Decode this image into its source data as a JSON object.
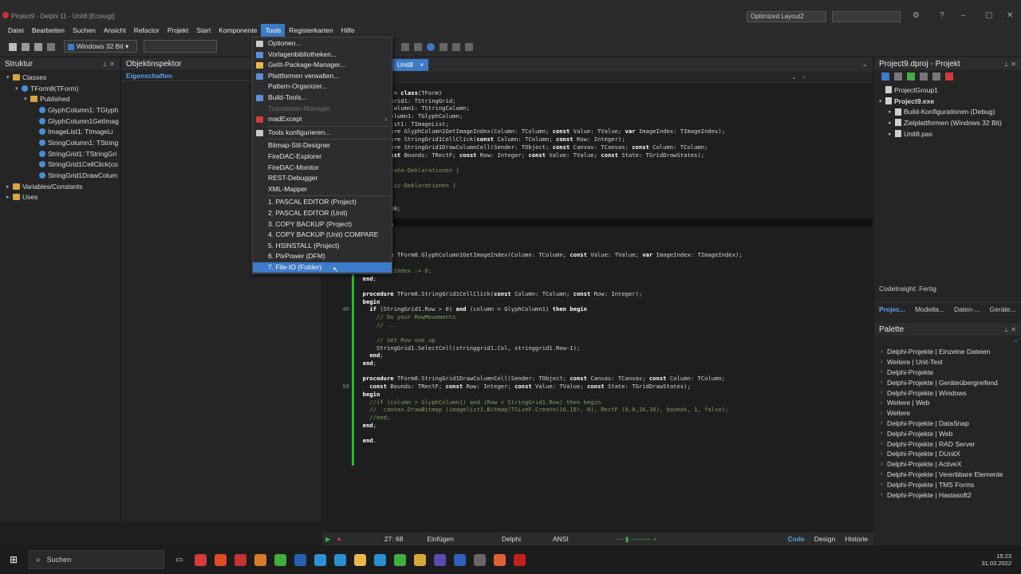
{
  "window": {
    "title": "Project9 - Delphi 11 - Unit8 [Erzeugt]",
    "layout": "Optimized Layout2"
  },
  "menubar": [
    "Datei",
    "Bearbeiten",
    "Suchen",
    "Ansicht",
    "Refactor",
    "Projekt",
    "Start",
    "Komponente",
    "Tools",
    "Registerkarten",
    "Hilfe"
  ],
  "toolbar": {
    "platform": "Windows 32 Bit"
  },
  "struktur": {
    "title": "Struktur",
    "items": [
      {
        "label": "Classes",
        "level": 0,
        "type": "folder",
        "toggle": "▾"
      },
      {
        "label": "TForm8(TForm)",
        "level": 1,
        "type": "comp",
        "toggle": "▾"
      },
      {
        "label": "Published",
        "level": 2,
        "type": "folder",
        "toggle": "▾"
      },
      {
        "label": "GlyphColumn1: TGlyph",
        "level": 3,
        "type": "comp",
        "toggle": ""
      },
      {
        "label": "GlyphColumn1GetImag",
        "level": 3,
        "type": "comp",
        "toggle": ""
      },
      {
        "label": "ImageList1: TImageLi",
        "level": 3,
        "type": "comp",
        "toggle": ""
      },
      {
        "label": "StringColumn1: TString",
        "level": 3,
        "type": "comp",
        "toggle": ""
      },
      {
        "label": "StringGrid1: TStringGri",
        "level": 3,
        "type": "comp",
        "toggle": ""
      },
      {
        "label": "StringGrid1CellClick(co",
        "level": 3,
        "type": "comp",
        "toggle": ""
      },
      {
        "label": "StringGrid1DrawColum",
        "level": 3,
        "type": "comp",
        "toggle": ""
      },
      {
        "label": "Variables/Constants",
        "level": 0,
        "type": "folder",
        "toggle": "▸"
      },
      {
        "label": "Uses",
        "level": 0,
        "type": "folder",
        "toggle": "▸"
      }
    ]
  },
  "objektinspektor": {
    "title": "Objektinspektor",
    "tab": "Eigenschaften"
  },
  "editor": {
    "tab": "Unit8",
    "tab_close": "×",
    "cursor_pos": "27: 68",
    "insert_mode": "Einfügen",
    "language": "Delphi",
    "encoding": "ANSI",
    "view_tabs": [
      "Code",
      "Design",
      "Historie"
    ],
    "code_lines": [
      {
        "n": "",
        "t": "           = class(TForm)"
      },
      {
        "n": "",
        "t": "      ringGrid1: TStringGrid;"
      },
      {
        "n": "",
        "t": "      ringColumn1: TStringColumn;"
      },
      {
        "n": "",
        "t": "      yphColumn1: TGlyphColumn;"
      },
      {
        "n": "",
        "t": "      ageList1: TImageList;"
      },
      {
        "n": "",
        "t": "      ocedure GlyphColumn1GetImageIndex(Column: TColumn; const Value: TValue; var ImageIndex: TImageIndex);"
      },
      {
        "n": "",
        "t": "      ocedure StringGrid1CellClick(const Column: TColumn; const Row: Integer);"
      },
      {
        "n": "",
        "t": "      ocedure StringGrid1DrawColumnCell(Sender: TObject; const Canvas: TCanvas; const Column: TColumn;"
      },
      {
        "n": "",
        "t": "        const Bounds: TRectF; const Row: Integer; const Value: TValue; const State: TGridDrawStates);"
      },
      {
        "n": "",
        "t": "      vate"
      },
      {
        "n": "",
        "t": "       Private-Deklarationen }"
      },
      {
        "n": "",
        "t": ""
      },
      {
        "n": "",
        "t": "       Public-Deklarationen }"
      },
      {
        "n": "",
        "t": ""
      },
      {
        "n": "",
        "t": ""
      },
      {
        "n": "",
        "t": "    : TForm8;"
      },
      {
        "n": "",
        "t": ""
      },
      {
        "n": "",
        "t": "  mentation"
      },
      {
        "n": "",
        "t": ""
      },
      {
        "n": "",
        "t": "  .fmx}"
      },
      {
        "n": "",
        "t": ""
      },
      {
        "n": "",
        "t": "  procedure TForm8.GlyphColumn1GetImageIndex(Column: TColumn; const Value: TValue; var ImageIndex: TImageIndex);"
      },
      {
        "n": "",
        "t": "  begin"
      },
      {
        "n": "",
        "t": "    //ImageIndex := 0;"
      },
      {
        "n": "",
        "t": "  end;"
      },
      {
        "n": "",
        "t": ""
      },
      {
        "n": "",
        "t": "  procedure TForm8.StringGrid1CellClick(const Column: TColumn; const Row: Integer);"
      },
      {
        "n": "",
        "t": "  begin"
      },
      {
        "n": "40",
        "t": "    if (StringGrid1.Row > 0) and (column = GlyphColumn1) then begin"
      },
      {
        "n": "",
        "t": "      // Do your RowMovements"
      },
      {
        "n": "",
        "t": "      // ..."
      },
      {
        "n": "",
        "t": ""
      },
      {
        "n": "",
        "t": "      // Set Row one up"
      },
      {
        "n": "",
        "t": "      StringGrid1.SelectCell(stringgrid1.Col, stringgrid1.Row-1);"
      },
      {
        "n": "",
        "t": "    end;"
      },
      {
        "n": "",
        "t": "  end;"
      },
      {
        "n": "",
        "t": ""
      },
      {
        "n": "",
        "t": "  procedure TForm8.StringGrid1DrawColumnCell(Sender: TObject; const Canvas: TCanvas; const Column: TColumn;"
      },
      {
        "n": "50",
        "t": "    const Bounds: TRectF; const Row: Integer; const Value: TValue; const State: TGridDrawStates);"
      },
      {
        "n": "",
        "t": "  begin"
      },
      {
        "n": "",
        "t": "    //if (column = GlyphColumn1) and (Row = StringGrid1.Row) then begin"
      },
      {
        "n": "",
        "t": "    //  canvas.DrawBitmap (imagelist1.Bitmap(TSizeF.Create(16,16), 0), RectF (0,0,16,16), bounds, 1, false);"
      },
      {
        "n": "",
        "t": "    //end;"
      },
      {
        "n": "",
        "t": "  end;"
      },
      {
        "n": "",
        "t": ""
      },
      {
        "n": "",
        "t": "  end."
      }
    ]
  },
  "tools_menu": {
    "items": [
      {
        "label": "Optionen...",
        "type": "item",
        "icon": "#c9c9c9"
      },
      {
        "label": "Vorlagenbibliotheken...",
        "type": "item",
        "icon": "#5b8fd6"
      },
      {
        "label": "GetIt-Package-Manager...",
        "type": "item",
        "icon": "#e8b84a"
      },
      {
        "label": "Plattformen verwalten...",
        "type": "item",
        "icon": "#5b8fd6"
      },
      {
        "label": "Pattern-Organizer...",
        "type": "item",
        "icon": ""
      },
      {
        "label": "Build-Tools...",
        "type": "item",
        "icon": "#5b8fd6"
      },
      {
        "label": "Translation-Manager",
        "type": "disabled",
        "icon": ""
      },
      {
        "label": "madExcept",
        "type": "submenu",
        "icon": "#d43b3b"
      },
      {
        "label": "",
        "type": "sep"
      },
      {
        "label": "Tools konfigurieren...",
        "type": "item",
        "icon": "#c9c9c9"
      },
      {
        "label": "",
        "type": "sep"
      },
      {
        "label": "Bitmap-Stil-Designer",
        "type": "item",
        "icon": ""
      },
      {
        "label": "FireDAC-Explorer",
        "type": "item",
        "icon": ""
      },
      {
        "label": "FireDAC-Monitor",
        "type": "item",
        "icon": ""
      },
      {
        "label": "REST-Debugger",
        "type": "item",
        "icon": ""
      },
      {
        "label": "XML-Mapper",
        "type": "item",
        "icon": ""
      },
      {
        "label": "",
        "type": "sep"
      },
      {
        "label": "1. PASCAL EDITOR (Project)",
        "type": "item",
        "icon": ""
      },
      {
        "label": "2. PASCAL EDITOR (Unit)",
        "type": "item",
        "icon": ""
      },
      {
        "label": "3. COPY BACKUP (Project)",
        "type": "item",
        "icon": ""
      },
      {
        "label": "4. COPY BACKUP (Unit) COMPARE",
        "type": "item",
        "icon": ""
      },
      {
        "label": "5. HSINSTALL (Project)",
        "type": "item",
        "icon": ""
      },
      {
        "label": "6. PixPower (DFM)",
        "type": "item",
        "icon": ""
      },
      {
        "label": "7. File-IO (Folder)",
        "type": "highlight",
        "icon": ""
      }
    ],
    "submenu_arrow": "›"
  },
  "project_panel": {
    "title": "Project9.dproj - Projekt",
    "items": [
      {
        "label": "ProjectGroup1",
        "level": 0,
        "bold": false,
        "toggle": ""
      },
      {
        "label": "Project9.exe",
        "level": 0,
        "bold": true,
        "toggle": "▾"
      },
      {
        "label": "Build-Konfigurationen (Debug)",
        "level": 1,
        "bold": false,
        "toggle": "▸"
      },
      {
        "label": "Zielplattformen (Windows 32 Bit)",
        "level": 1,
        "bold": false,
        "toggle": "▸"
      },
      {
        "label": "Unit8.pas",
        "level": 1,
        "bold": false,
        "toggle": "▸"
      }
    ],
    "status": "CodeInsight: Fertig",
    "tabs": [
      "Projec...",
      "Modella...",
      "Daten-...",
      "Geräte..."
    ]
  },
  "palette": {
    "title": "Palette",
    "items": [
      "Delphi-Projekte | Einzelne Dateien",
      "Weitere | Unit-Test",
      "Delphi-Projekte",
      "Delphi-Projekte | Geräteübergreifend",
      "Delphi-Projekte | Windows",
      "Weitere | Web",
      "Weitere",
      "Delphi-Projekte | DataSnap",
      "Delphi-Projekte | Web",
      "Delphi-Projekte | RAD Server",
      "Delphi-Projekte | DUnitX",
      "Delphi-Projekte | ActiveX",
      "Delphi-Projekte | Vererbbare Elemente",
      "Delphi-Projekte | TMS Forms",
      "Delphi-Projekte | Hastasoft2"
    ]
  },
  "taskbar": {
    "search": "Suchen",
    "time": "15:23",
    "date": "31.03.2022",
    "apps": [
      "#d43b3b",
      "#e04a2a",
      "#c83232",
      "#d97a2a",
      "#3fae3f",
      "#2a5fb0",
      "#2f8fd8",
      "#2a8fcf",
      "#e8b84a",
      "#2a8fcf",
      "#3fae3f",
      "#d8a83a",
      "#5a4ab0",
      "#3060c0",
      "#666666",
      "#e06030",
      "#c02020"
    ]
  },
  "colors": {
    "accent": "#3d7ac8",
    "keyword": "#ffffff",
    "comment": "#7f9f5f"
  }
}
